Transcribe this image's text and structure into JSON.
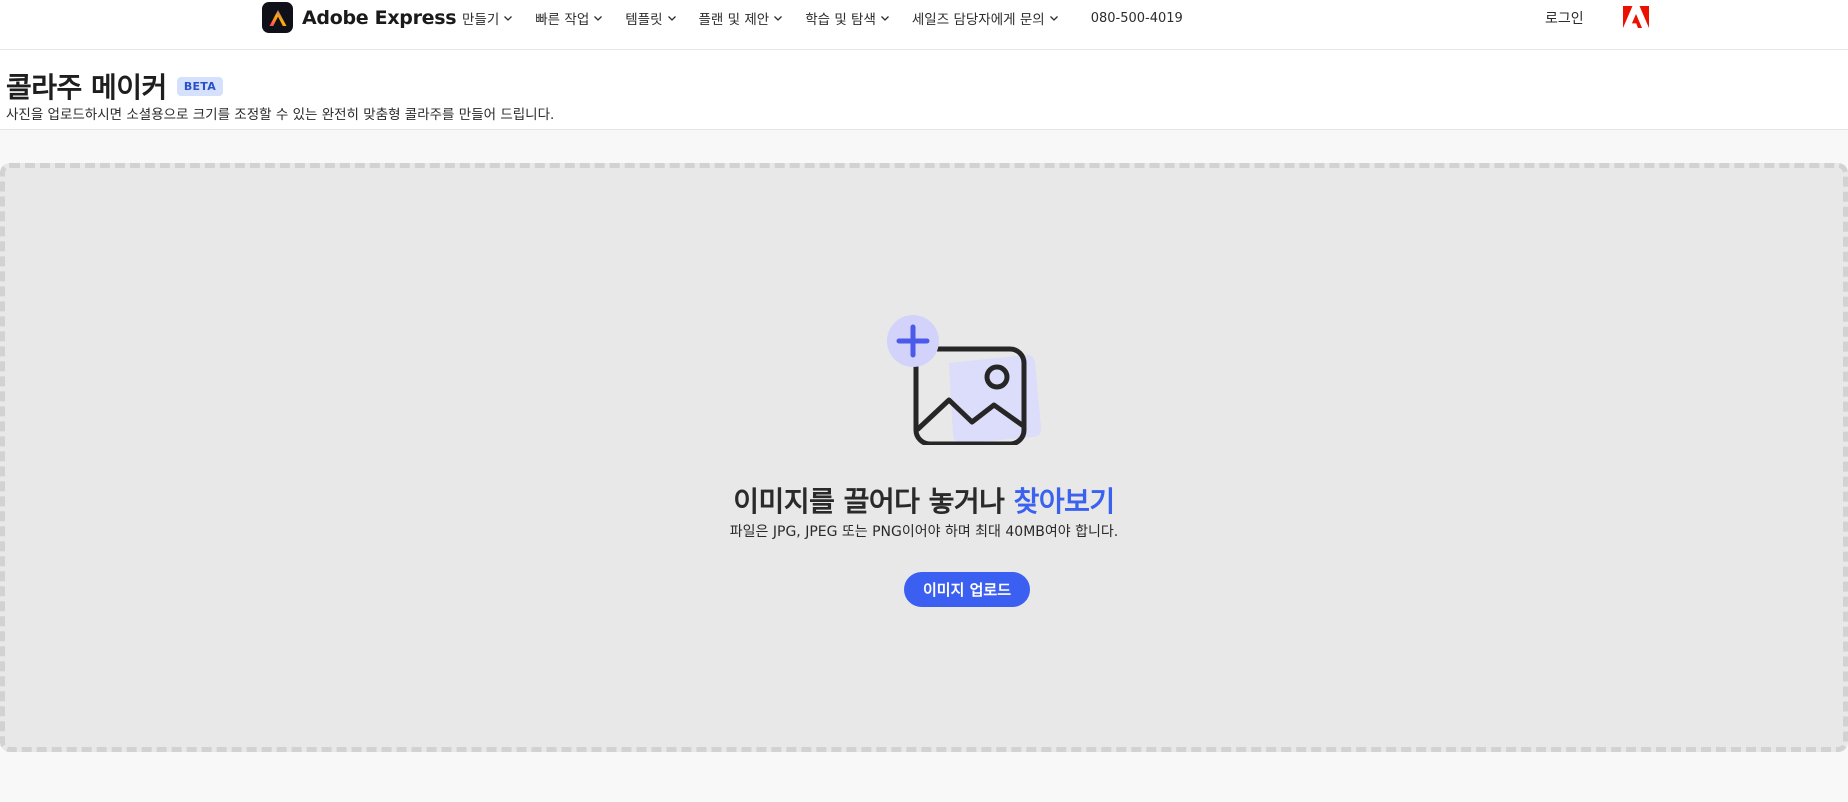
{
  "header": {
    "brand": "Adobe Express",
    "menu": [
      {
        "label": "만들기"
      },
      {
        "label": "빠른 작업"
      },
      {
        "label": "템플릿"
      },
      {
        "label": "플랜 및 제안"
      },
      {
        "label": "학습 및 탐색"
      },
      {
        "label": "세일즈 담당자에게 문의"
      }
    ],
    "phone": "080-500-4019",
    "login": "로그인"
  },
  "page": {
    "title": "콜라주 메이커",
    "badge": "BETA",
    "subtitle": "사진을 업로드하시면 소셜용으로 크기를 조정할 수 있는 완전히 맞춤형 콜라주를 만들어 드립니다."
  },
  "dropzone": {
    "title_prefix": "이미지를 끌어다 놓거나 ",
    "browse_link": "찾아보기",
    "hint": "파일은 JPG, JPEG 또는 PNG이어야 하며 최대 40MB여야 합니다.",
    "upload_button": "이미지 업로드"
  },
  "colors": {
    "accent": "#3b5ff1",
    "link": "#3a62ef",
    "dropzone_bg": "#e8e8e8",
    "badge_bg": "#d5e1fc",
    "adobe_red": "#eb1000"
  },
  "icons": [
    "adobe-express-logo-icon",
    "chevron-down-icon",
    "adobe-logo-icon",
    "add-image-icon"
  ]
}
